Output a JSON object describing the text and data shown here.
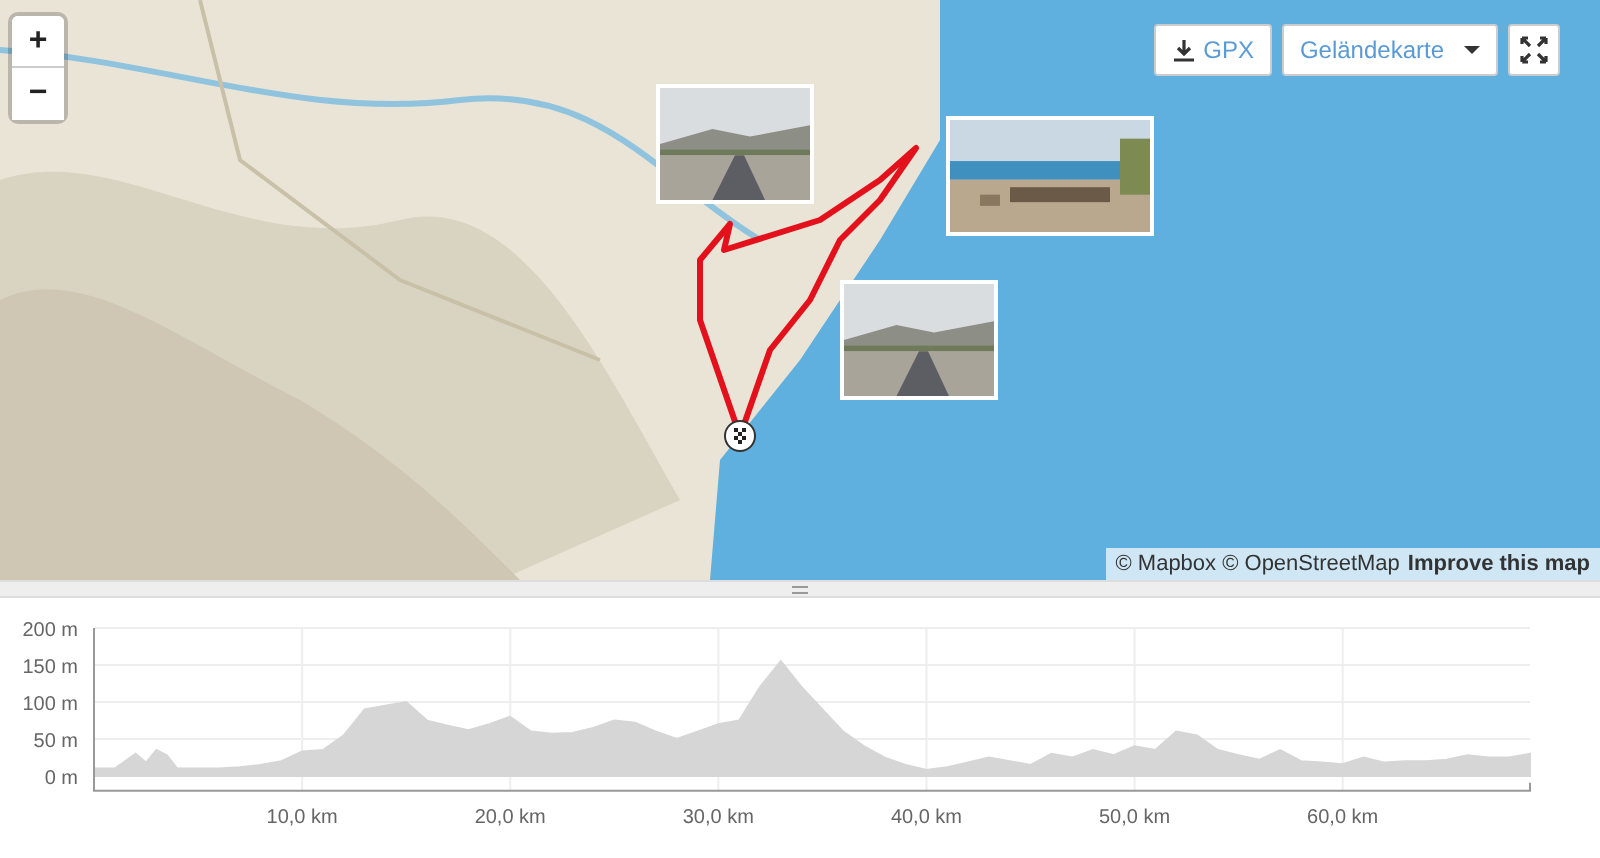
{
  "map": {
    "zoom_in": "+",
    "zoom_out": "−",
    "gpx_button": "GPX",
    "map_type": "Geländekarte",
    "attribution": "© Mapbox © OpenStreetMap",
    "improve_link": "Improve this map"
  },
  "elevation_profile": {
    "chart_data": {
      "type": "area",
      "grid": true,
      "xlim": [
        0,
        69
      ],
      "ylim": [
        -20,
        200
      ],
      "x": [
        0,
        1,
        2,
        2.5,
        3,
        3.5,
        4,
        5,
        6,
        7,
        8,
        9,
        10,
        11,
        12,
        13,
        14,
        15,
        16,
        17,
        18,
        19,
        20,
        21,
        22,
        23,
        24,
        25,
        26,
        27,
        28,
        29,
        30,
        31,
        32,
        33,
        34,
        35,
        36,
        37,
        38,
        39,
        40,
        41,
        42,
        43,
        44,
        45,
        46,
        47,
        48,
        49,
        50,
        51,
        52,
        53,
        54,
        55,
        56,
        57,
        58,
        59,
        60,
        61,
        62,
        63,
        64,
        65,
        66,
        67,
        68,
        69
      ],
      "series": [
        {
          "color": "#d6d6d6",
          "values": [
            10,
            10,
            30,
            18,
            35,
            28,
            10,
            10,
            10,
            12,
            15,
            20,
            33,
            35,
            55,
            90,
            95,
            100,
            75,
            68,
            62,
            70,
            80,
            60,
            57,
            58,
            65,
            75,
            72,
            60,
            50,
            60,
            70,
            75,
            120,
            155,
            120,
            90,
            60,
            40,
            25,
            15,
            8,
            12,
            18,
            25,
            20,
            15,
            30,
            25,
            35,
            28,
            40,
            35,
            60,
            55,
            35,
            28,
            22,
            35,
            20,
            18,
            16,
            25,
            18,
            20,
            20,
            22,
            28,
            25,
            25,
            30
          ]
        }
      ],
      "yticks": [
        {
          "value": 0,
          "label": "0 m"
        },
        {
          "value": 50,
          "label": "50 m"
        },
        {
          "value": 100,
          "label": "100 m"
        },
        {
          "value": 150,
          "label": "150 m"
        },
        {
          "value": 200,
          "label": "200 m"
        }
      ],
      "xticks": [
        {
          "value": 10,
          "label": "10,0 km"
        },
        {
          "value": 20,
          "label": "20,0 km"
        },
        {
          "value": 30,
          "label": "30,0 km"
        },
        {
          "value": 40,
          "label": "40,0 km"
        },
        {
          "value": 50,
          "label": "50,0 km"
        },
        {
          "value": 60,
          "label": "60,0 km"
        }
      ]
    }
  }
}
